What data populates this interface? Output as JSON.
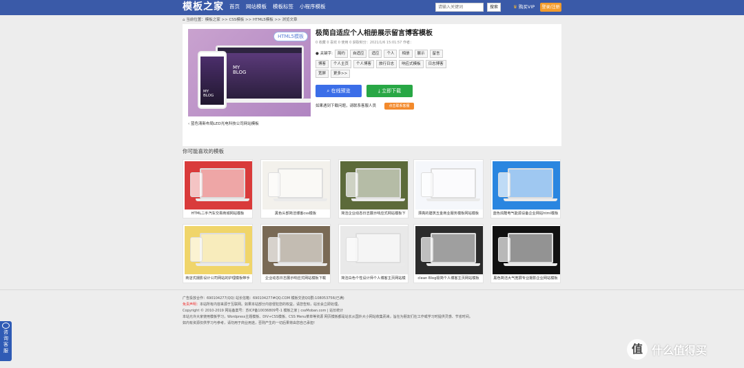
{
  "header": {
    "logo": "模板之家",
    "nav": [
      "首页",
      "网站模板",
      "模板标签",
      "小程序模板"
    ],
    "search_placeholder": "请输入关键词",
    "search_button": "搜索",
    "vip": "购买VIP",
    "login": "登录/注册"
  },
  "breadcrumb": "当前位置：模板之家 >> CSS模板 >> HTML5模板 >> 浏览文章",
  "detail": {
    "thumb_tag": "HTML5模板",
    "thumb_blog_line1": "MY",
    "thumb_blog_line2": "BLOG",
    "title": "极简自适应个人相册展示留言博客模板",
    "meta": "0 收藏   0 喜欢    0 使用    0 获取积分：2021/1/6 15:01:57 作者：",
    "keywords_label": "关键字:",
    "keywords_row1": [
      "简约",
      "自适应",
      "适应",
      "个人",
      "相册",
      "展示",
      "留言"
    ],
    "keywords_row2": [
      "博客",
      "个人主页",
      "个人博客",
      "旅行日志",
      "响应式模板",
      "日志博客"
    ],
    "keywords_row3": [
      "宽屏",
      "更多>>"
    ],
    "preview_button": "在线预览",
    "download_button": "立即下载",
    "problem_text": "如果遇到下载问题，请联系客服人员",
    "contact_button": "点击联系客服",
    "prev_link": "蓝色清新布局LED光电科技公司网站模板"
  },
  "related": {
    "title": "你可能喜欢的模板",
    "cards": [
      {
        "caption": "HTML二手汽车交易商城网站模板",
        "color": "#d93b3b"
      },
      {
        "caption": "黑色头部简洁博客css模板",
        "color": "#f3f1ec"
      },
      {
        "caption": "简洁企业动态日志展示响应式网站模板下",
        "color": "#5c6a3a"
      },
      {
        "caption": "漂亮的建筑五金商业服务模板网站模板",
        "color": "#f5f7fb"
      },
      {
        "caption": "蓝色炫酷电气能源设备企业网站html模板",
        "color": "#2a86e0"
      },
      {
        "caption": "商店式摄影设计公司网站的护理模板带手",
        "color": "#f0d56a"
      },
      {
        "caption": "企业动态日志展示响应式网站模板下载",
        "color": "#7a6a55"
      },
      {
        "caption": "简洁白色个性设计师个人博客主页网站模",
        "color": "#e9e9e9"
      },
      {
        "caption": "clean Blog极简个人博客主页网站模板",
        "color": "#2b2b2b"
      },
      {
        "caption": "黑色简洁大气宽屏专业摄影企业网站模板",
        "color": "#111111"
      }
    ]
  },
  "footer": {
    "line1": "广告投放合作：690104277(QQ) 站长信箱：690104277#QQ.COM 模板交流QQ群:108053756(已满)",
    "line2_warn": "免责声明：",
    "line2": "本站所有内容来源于互联网。如果本站部分内容侵犯您的权益，请您告知，站长会立即处理。",
    "line3": "Copyright © 2010-2019 网站备案号：苏ICP备10036809号-1 模板之家 | cssMoban.com | 站长统计",
    "line4": "本站允许大家使用模板学习，Wordpress主题模板、DIV+CSS模板、CSS Menu菜单等资源 网页模板都是站长从国外大小网站收集而来，旨在为朋友们在工作或学习时提供灵感、节省时间。",
    "line5": "如内有资源仅供学习与参考，请勿用于商业用途，否则产生的一切后果将由您自己承担!"
  },
  "side_service": "咨询客服",
  "watermark": "什么值得买"
}
